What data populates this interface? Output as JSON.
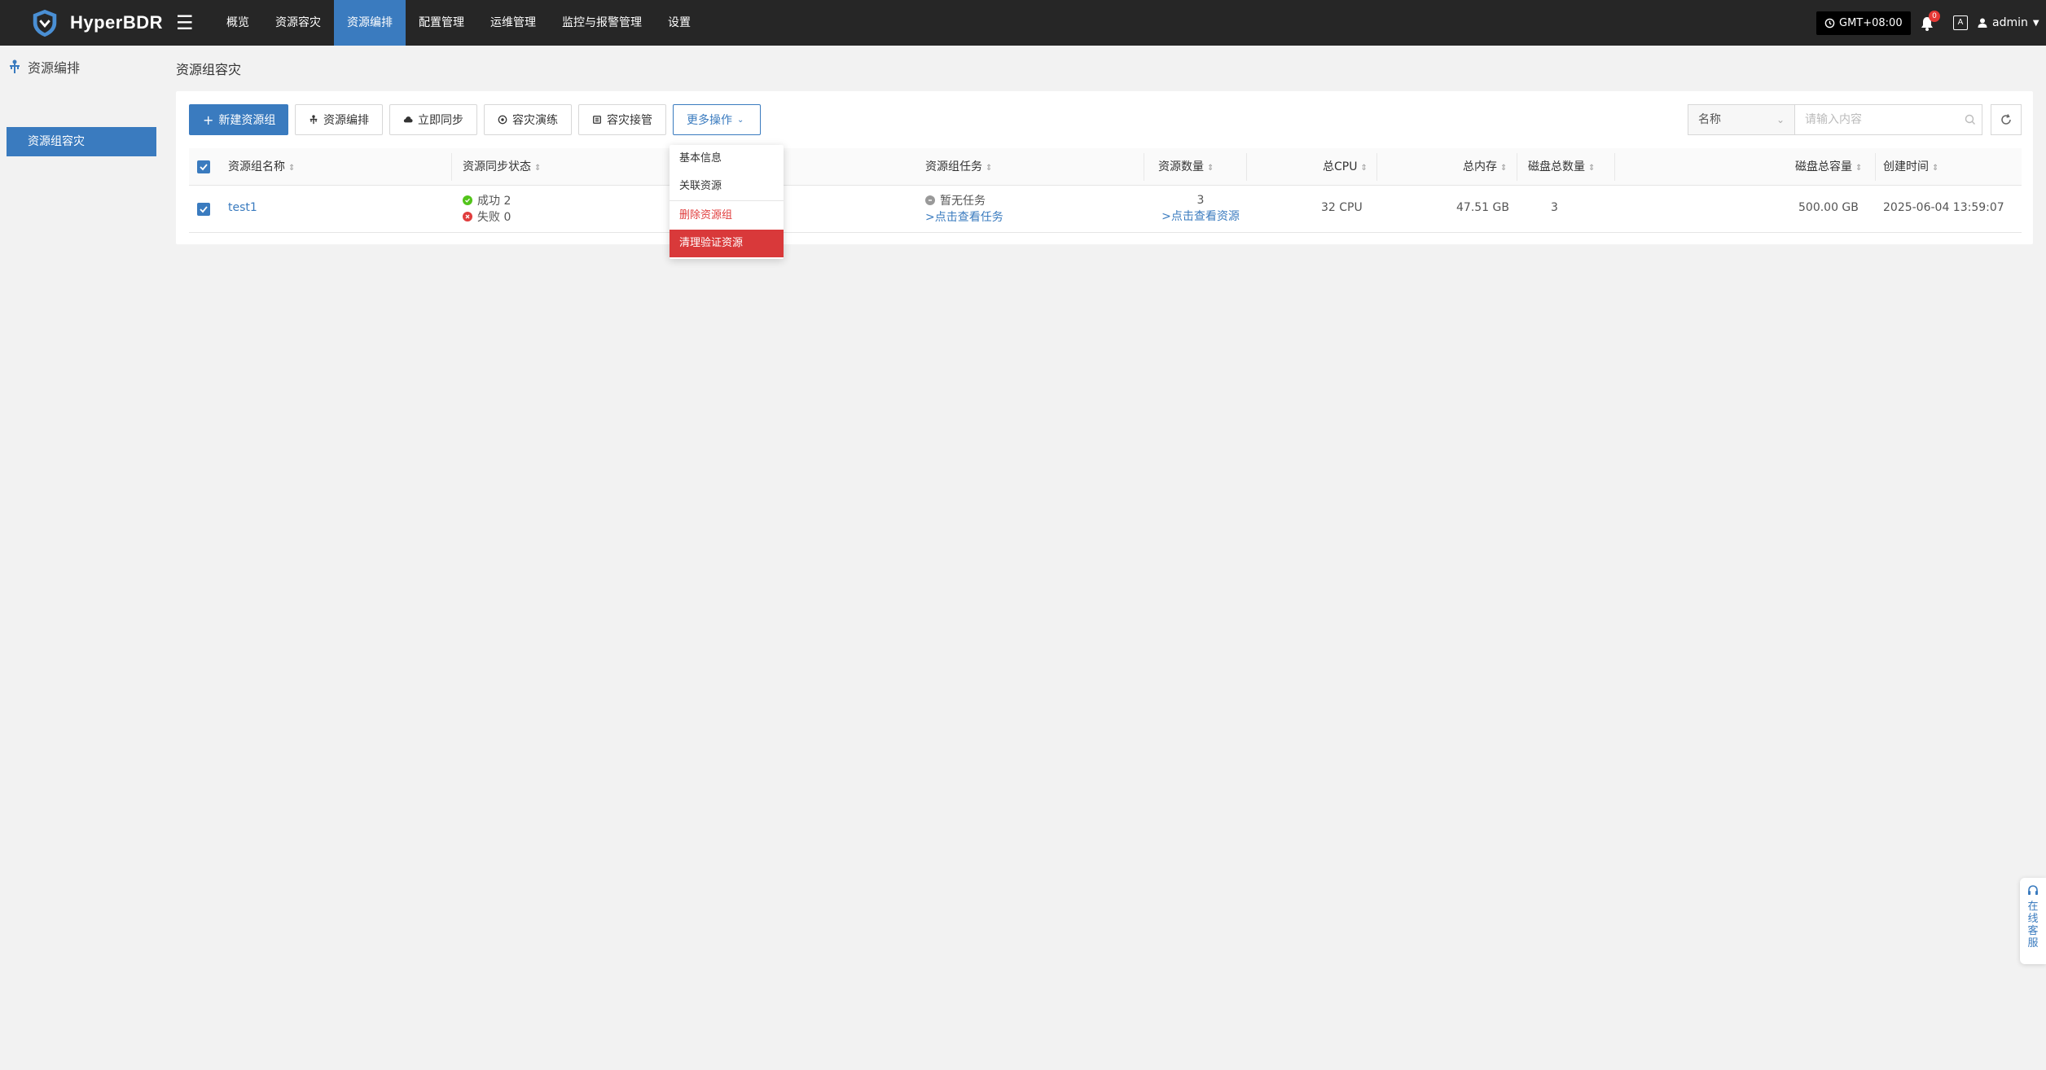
{
  "app": {
    "name": "HyperBDR"
  },
  "nav": {
    "menu_icon": "☰",
    "items": [
      "概览",
      "资源容灾",
      "资源编排",
      "配置管理",
      "运维管理",
      "监控与报警管理",
      "设置"
    ],
    "timezone": "GMT+08:00",
    "notification_count": "0",
    "lang_icon": "A",
    "user": "admin"
  },
  "sidebar": {
    "title": "资源编排",
    "items": [
      "资源组容灾"
    ]
  },
  "page": {
    "title": "资源组容灾"
  },
  "toolbar": {
    "new": "新建资源组",
    "orchestrate": "资源编排",
    "sync": "立即同步",
    "drill": "容灾演练",
    "takeover": "容灾接管",
    "more": "更多操作"
  },
  "search": {
    "field": "名称",
    "placeholder": "请输入内容"
  },
  "table": {
    "headers": [
      "资源组名称",
      "资源同步状态",
      "资源组任务",
      "资源数量",
      "总CPU",
      "总内存",
      "磁盘总数量",
      "磁盘总容量",
      "创建时间"
    ],
    "rows": [
      {
        "name": "test1",
        "sync_success": "成功 2",
        "sync_fail": "失败 0",
        "task": "暂无任务",
        "task_link": ">点击查看任务",
        "resource_count": "3",
        "resource_link": ">点击查看资源",
        "cpu": "32 CPU",
        "memory": "47.51 GB",
        "disk_count": "3",
        "disk_capacity": "500.00 GB",
        "created": "2025-06-04 13:59:07"
      }
    ]
  },
  "dropdown": {
    "items": [
      "基本信息",
      "关联资源",
      "删除资源组",
      "清理验证资源"
    ]
  },
  "service": {
    "label": "在线客服"
  },
  "colors": {
    "primary": "#3a7bbf",
    "topbar": "#262626",
    "danger": "#d9393a",
    "success": "#52c41a"
  }
}
